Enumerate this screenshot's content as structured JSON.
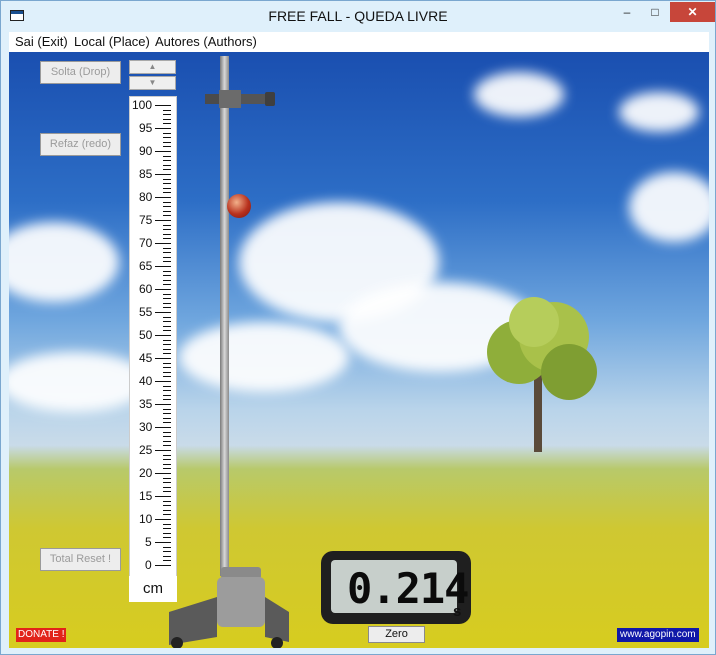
{
  "window": {
    "title": "FREE FALL - QUEDA LIVRE",
    "min_glyph": "–",
    "max_glyph": "□",
    "close_glyph": "✕"
  },
  "menu": [
    {
      "label": "Sai (Exit)"
    },
    {
      "label": "Local (Place)"
    },
    {
      "label": "Autores (Authors)"
    }
  ],
  "controls": {
    "drop_label": "Solta (Drop)",
    "redo_label": "Refaz (redo)",
    "reset_label": "Total Reset !",
    "spin_up": "▲",
    "spin_down": "▼"
  },
  "ruler": {
    "unit": "cm",
    "labels": [
      "100",
      "95",
      "90",
      "85",
      "80",
      "75",
      "70",
      "65",
      "60",
      "55",
      "50",
      "45",
      "40",
      "35",
      "30",
      "25",
      "20",
      "15",
      "10",
      "5",
      "0"
    ]
  },
  "timer": {
    "value": "0.214",
    "unit": "s",
    "zero_label": "Zero"
  },
  "footer": {
    "donate_label": "DONATE !",
    "website_label": "www.agopin.com"
  },
  "colors": {
    "close": "#c7463a",
    "donate": "#e2231a",
    "website": "#1018a8"
  },
  "icons": {
    "app": "app-window-icon"
  }
}
